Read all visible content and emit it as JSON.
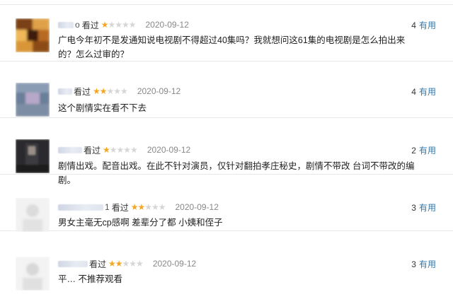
{
  "reviews": [
    {
      "name_suffix": "o",
      "watched": "看过",
      "stars_icon": "★☆☆☆☆",
      "rating": 1,
      "date": "2020-09-12",
      "useful_count": "4",
      "useful_label": "有用",
      "text": "广电今年初不是发通知说电视剧不得超过40集吗？我就想问这61集的电视剧是怎么拍出来的？怎么过审的？"
    },
    {
      "name_suffix": "",
      "watched": "看过",
      "stars_icon": "★★☆☆☆",
      "rating": 2,
      "date": "2020-09-12",
      "useful_count": "4",
      "useful_label": "有用",
      "text": "这个剧情实在看不下去"
    },
    {
      "name_suffix": "",
      "watched": "看过",
      "stars_icon": "★☆☆☆☆",
      "rating": 1,
      "date": "2020-09-12",
      "useful_count": "2",
      "useful_label": "有用",
      "text": "剧情出戏。配音出戏。在此不针对演员，仅针对翻拍孝庄秘史，剧情不带改 台词不带改的编剧。"
    },
    {
      "name_suffix": "1",
      "watched": "看过",
      "stars_icon": "★★☆☆☆",
      "rating": 2,
      "date": "2020-09-12",
      "useful_count": "3",
      "useful_label": "有用",
      "text": "男女主毫无cp感啊 差辈分了都 小姨和侄子"
    },
    {
      "name_suffix": "",
      "watched": "看过",
      "stars_icon": "★★☆☆☆",
      "rating": 2,
      "date": "2020-09-12",
      "useful_count": "3",
      "useful_label": "有用",
      "text": "平… 不推荐观看"
    }
  ],
  "colors": {
    "link": "#3377aa",
    "star_on": "#f5a623",
    "star_off": "#d6d6d6",
    "divider": "#e8e8e8"
  }
}
